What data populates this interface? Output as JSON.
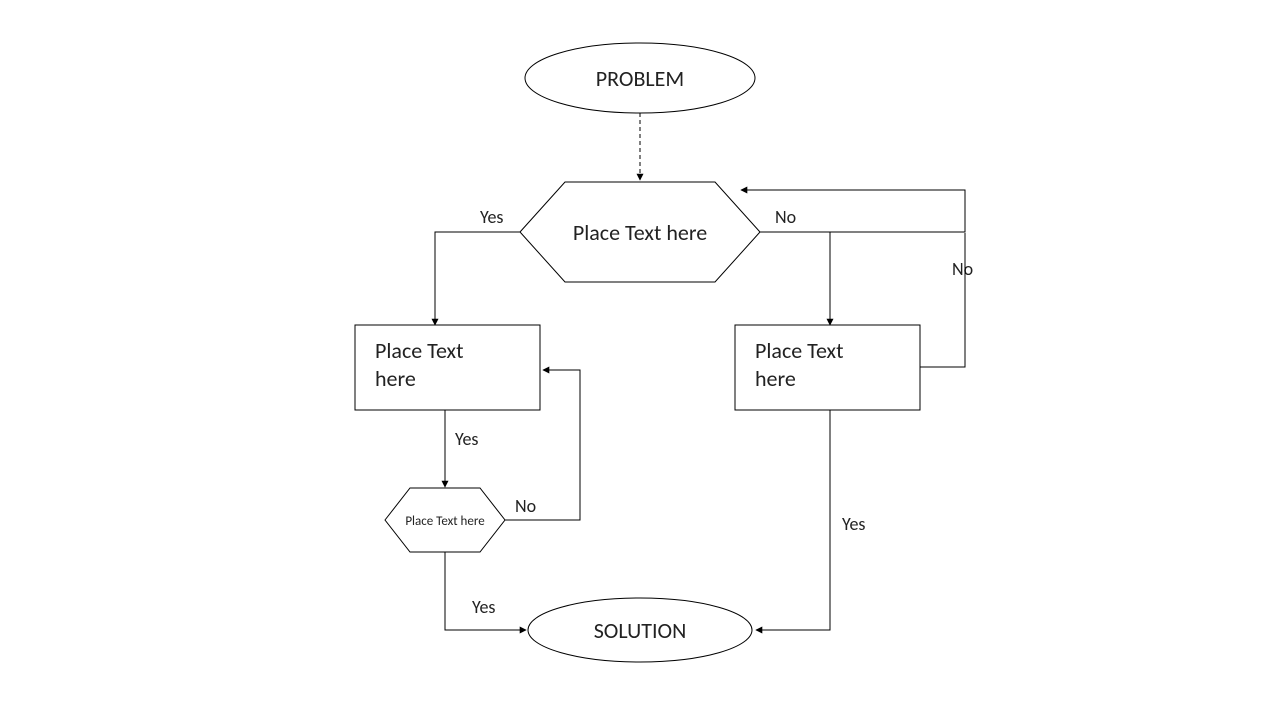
{
  "nodes": {
    "problem": "PROBLEM",
    "decision1": "Place Text here",
    "processLeft_l1": "Place Text",
    "processLeft_l2": "here",
    "processRight_l1": "Place Text",
    "processRight_l2": "here",
    "decisionSmall": "Place Text here",
    "solution": "SOLUTION"
  },
  "edges": {
    "yes1": "Yes",
    "no1": "No",
    "yes2": "Yes",
    "no2": "No",
    "yes3": "Yes",
    "no3": "No",
    "yes4": "Yes"
  }
}
